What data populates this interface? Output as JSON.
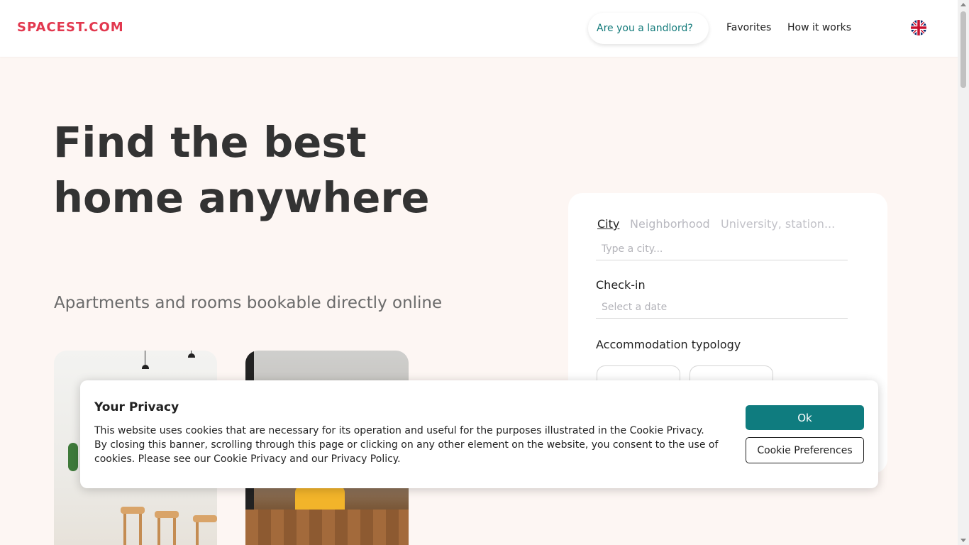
{
  "header": {
    "logo": "SPACEST.COM",
    "landlord_link": "Are you a landlord?",
    "nav": [
      "Favorites",
      "How it works"
    ],
    "language_icon": "uk-flag-icon"
  },
  "hero": {
    "title": "Find the best home anywhere",
    "subtitle": "Apartments and rooms bookable directly online"
  },
  "search": {
    "tabs": [
      "City",
      "Neighborhood",
      "University, station..."
    ],
    "city_placeholder": "Type a city...",
    "checkin_label": "Check-in",
    "date_placeholder": "Select a date",
    "accommodation_label": "Accommodation typology"
  },
  "cookie_banner": {
    "title": "Your Privacy",
    "text": "This website uses cookies that are necessary for its operation and useful for the purposes illustrated in the Cookie Privacy. By closing this banner, scrolling through this page or clicking on any other element on the website, you consent to the use of cookies. Please see our Cookie Privacy and our Privacy Policy.",
    "ok_button": "Ok",
    "preferences_button": "Cookie Preferences"
  },
  "colors": {
    "brand": "#e2384f",
    "teal": "#0f7c7f",
    "background": "#fdf6f3"
  }
}
